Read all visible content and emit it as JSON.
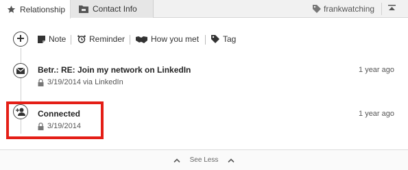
{
  "tabs": {
    "relationship": {
      "label": "Relationship",
      "icon": "star-icon"
    },
    "contact_info": {
      "label": "Contact Info",
      "icon": "folder-icon"
    }
  },
  "header": {
    "tag_label": "frankwatching",
    "tag_icon": "tag-icon",
    "collapse_icon": "collapse-up-icon"
  },
  "actions": [
    {
      "label": "Note",
      "icon": "note-icon"
    },
    {
      "label": "Reminder",
      "icon": "alarm-clock-icon"
    },
    {
      "label": "How you met",
      "icon": "handshake-icon"
    },
    {
      "label": "Tag",
      "icon": "tag-icon"
    }
  ],
  "timeline": [
    {
      "icon": "envelope-icon",
      "title": "Betr.: RE: Join my network on LinkedIn",
      "meta": "3/19/2014 via LinkedIn",
      "time": "1 year ago"
    },
    {
      "icon": "add-connection-icon",
      "title": "Connected",
      "meta": "3/19/2014",
      "time": "1 year ago"
    }
  ],
  "footer": {
    "label": "See Less"
  },
  "colors": {
    "highlight": "#e41e16",
    "tab_bar": "#f1f1f1",
    "text": "#333333"
  }
}
